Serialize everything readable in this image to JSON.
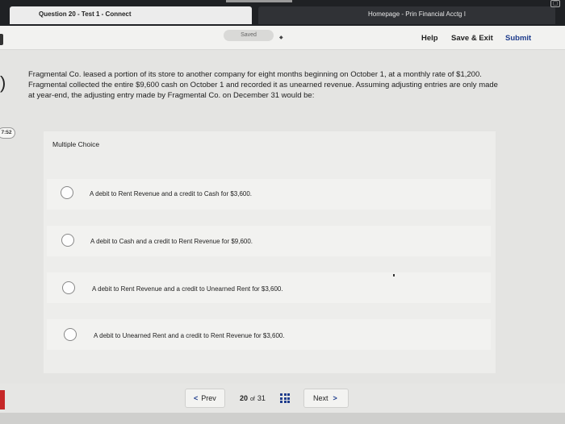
{
  "browser": {
    "tabs": [
      {
        "title": "Question 20 - Test 1 - Connect"
      },
      {
        "title": "Homepage - Prin Financial Acctg I"
      }
    ]
  },
  "header": {
    "saved_label": "Saved",
    "help_label": "Help",
    "save_exit_label": "Save & Exit",
    "submit_label": "Submit"
  },
  "timer": {
    "value": "7:52"
  },
  "question": {
    "text": "Fragmental Co. leased a portion of its store to another company for eight months beginning on October 1, at a monthly rate of $1,200. Fragmental collected the entire $9,600 cash on October 1 and recorded it as unearned revenue. Assuming adjusting entries are only made at year-end, the adjusting entry made by Fragmental Co. on December 31 would be:",
    "type_label": "Multiple Choice",
    "options": [
      {
        "text": "A debit to Rent Revenue and a credit to Cash for $3,600."
      },
      {
        "text": "A debit to Cash and a credit to Rent Revenue for $9,600."
      },
      {
        "text": "A debit to Rent Revenue and a credit to Unearned Rent for $3,600."
      },
      {
        "text": "A debit to Unearned Rent and a credit to Rent Revenue for $3,600."
      }
    ]
  },
  "footer": {
    "prev_label": "Prev",
    "current_page": "20",
    "of_label": "of",
    "total_pages": "31",
    "next_label": "Next"
  },
  "colors": {
    "accent": "#1e3c8c",
    "browser_bar": "#1f2124",
    "background": "#e4e4e2"
  }
}
